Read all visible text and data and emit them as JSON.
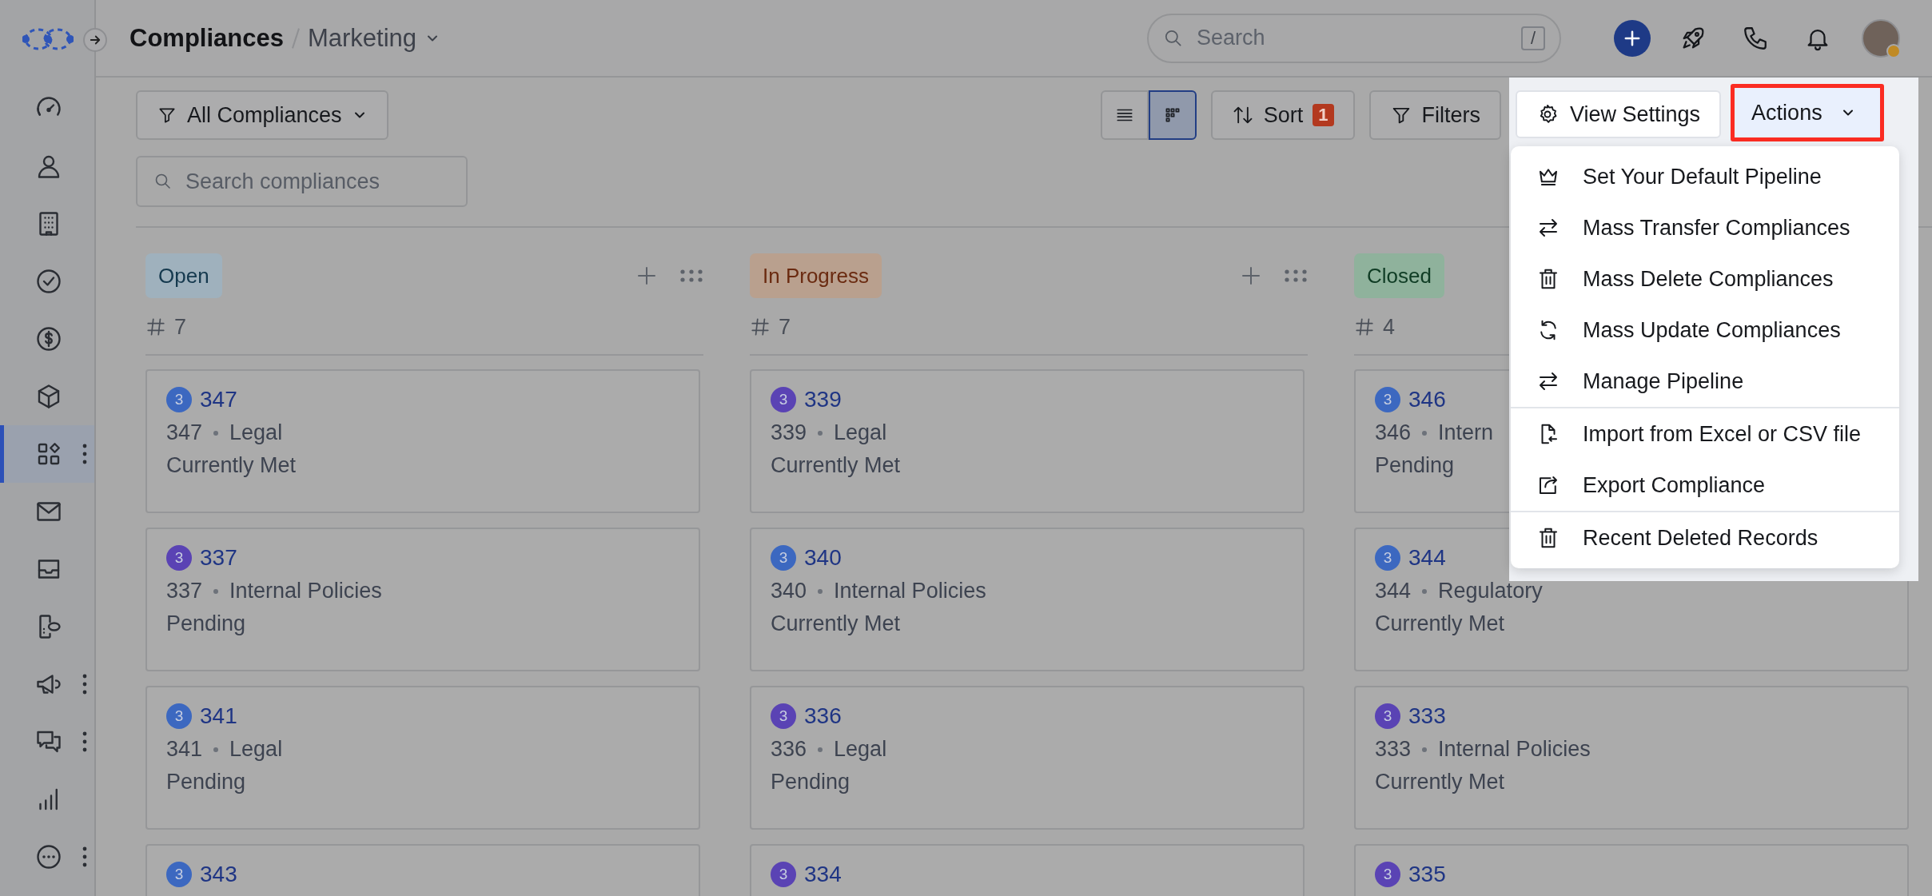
{
  "header": {
    "title": "Compliances",
    "pipeline": "Marketing",
    "search": {
      "placeholder": "Search",
      "shortcut": "/"
    }
  },
  "sidebar": {
    "items": [
      {
        "selected": false,
        "has_menu": false
      },
      {
        "selected": false,
        "has_menu": false
      },
      {
        "selected": false,
        "has_menu": false
      },
      {
        "selected": false,
        "has_menu": false
      },
      {
        "selected": false,
        "has_menu": false
      },
      {
        "selected": false,
        "has_menu": false
      },
      {
        "selected": true,
        "has_menu": true
      },
      {
        "selected": false,
        "has_menu": false
      },
      {
        "selected": false,
        "has_menu": false
      },
      {
        "selected": false,
        "has_menu": false
      },
      {
        "selected": false,
        "has_menu": true
      },
      {
        "selected": false,
        "has_menu": true
      },
      {
        "selected": false,
        "has_menu": false
      },
      {
        "selected": false,
        "has_menu": true
      }
    ]
  },
  "toolbar": {
    "view_filter": "All Compliances",
    "view_modes": [
      {
        "selected": false
      },
      {
        "selected": true
      }
    ],
    "sort": {
      "label": "Sort",
      "badge": "1"
    },
    "filters": "Filters",
    "view_settings": "View Settings",
    "actions": {
      "label": "Actions",
      "highlighted": true
    }
  },
  "search": {
    "placeholder": "Search compliances"
  },
  "columns": [
    {
      "title": "Open",
      "color": "#9fb1bd",
      "count": "7",
      "cards": [
        {
          "badge": "3",
          "color": "#3c68c0",
          "title": "347",
          "id": "347",
          "category": "Legal",
          "status": "Currently Met"
        },
        {
          "badge": "3",
          "color": "#5a43b4",
          "title": "337",
          "id": "337",
          "category": "Internal Policies",
          "status": "Pending"
        },
        {
          "badge": "3",
          "color": "#3c68c0",
          "title": "341",
          "id": "341",
          "category": "Legal",
          "status": "Pending"
        },
        {
          "badge": "3",
          "color": "#3c68c0",
          "title": "343"
        }
      ]
    },
    {
      "title": "In Progress",
      "color": "#b9a08e",
      "count": "7",
      "cards": [
        {
          "badge": "3",
          "color": "#5a43b4",
          "title": "339",
          "id": "339",
          "category": "Legal",
          "status": "Currently Met"
        },
        {
          "badge": "3",
          "color": "#3c68c0",
          "title": "340",
          "id": "340",
          "category": "Internal Policies",
          "status": "Currently Met"
        },
        {
          "badge": "3",
          "color": "#5a43b4",
          "title": "336",
          "id": "336",
          "category": "Legal",
          "status": "Pending"
        },
        {
          "badge": "3",
          "color": "#5a43b4",
          "title": "334"
        }
      ]
    },
    {
      "title": "Closed",
      "color": "#8fb29c",
      "count": "4",
      "cards": [
        {
          "badge": "3",
          "color": "#3c68c0",
          "title": "346",
          "id": "346",
          "category": "Intern",
          "status": "Pending"
        },
        {
          "badge": "3",
          "color": "#3c68c0",
          "title": "344",
          "id": "344",
          "category": "Regulatory",
          "status": "Currently Met"
        },
        {
          "badge": "3",
          "color": "#5a43b4",
          "title": "333",
          "id": "333",
          "category": "Internal Policies",
          "status": "Currently Met"
        },
        {
          "badge": "3",
          "color": "#5a43b4",
          "title": "335"
        }
      ]
    }
  ],
  "actions_menu": {
    "groups": [
      [
        "Set Your Default Pipeline",
        "Mass Transfer Compliances",
        "Mass Delete Compliances",
        "Mass Update Compliances",
        "Manage Pipeline"
      ],
      [
        "Import from Excel or CSV file",
        "Export Compliance"
      ],
      [
        "Recent Deleted Records"
      ]
    ]
  }
}
